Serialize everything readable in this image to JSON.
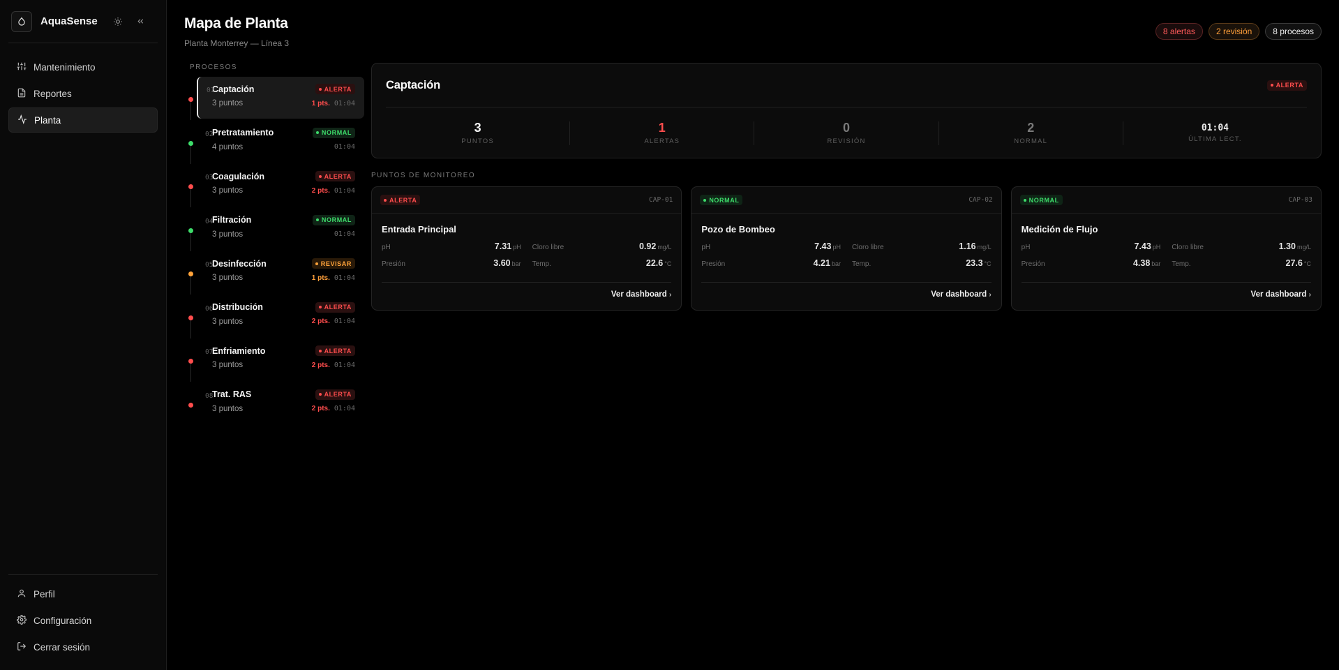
{
  "brand": {
    "name": "AquaSense"
  },
  "nav": [
    {
      "label": "Mantenimiento",
      "icon": "sliders-icon"
    },
    {
      "label": "Reportes",
      "icon": "file-icon"
    },
    {
      "label": "Planta",
      "icon": "activity-icon"
    }
  ],
  "nav_bottom": [
    {
      "label": "Perfil",
      "icon": "user-icon"
    },
    {
      "label": "Configuración",
      "icon": "gear-icon"
    },
    {
      "label": "Cerrar sesión",
      "icon": "logout-icon"
    }
  ],
  "header": {
    "title": "Mapa de Planta",
    "subtitle": "Planta Monterrey — Línea 3",
    "badges": {
      "alerts": "8 alertas",
      "review": "2 revisión",
      "processes": "8 procesos"
    }
  },
  "processes": {
    "heading": "PROCESOS",
    "items": [
      {
        "num": "01",
        "name": "Captación",
        "points": "3 puntos",
        "status": "ALERTA",
        "pts": "1 pts.",
        "time": "01:04"
      },
      {
        "num": "02",
        "name": "Pretratamiento",
        "points": "4 puntos",
        "status": "NORMAL",
        "pts": "",
        "time": "01:04"
      },
      {
        "num": "03",
        "name": "Coagulación",
        "points": "3 puntos",
        "status": "ALERTA",
        "pts": "2 pts.",
        "time": "01:04"
      },
      {
        "num": "04",
        "name": "Filtración",
        "points": "3 puntos",
        "status": "NORMAL",
        "pts": "",
        "time": "01:04"
      },
      {
        "num": "05",
        "name": "Desinfección",
        "points": "3 puntos",
        "status": "REVISAR",
        "pts": "1 pts.",
        "time": "01:04"
      },
      {
        "num": "06",
        "name": "Distribución",
        "points": "3 puntos",
        "status": "ALERTA",
        "pts": "2 pts.",
        "time": "01:04"
      },
      {
        "num": "07",
        "name": "Enfriamiento",
        "points": "3 puntos",
        "status": "ALERTA",
        "pts": "2 pts.",
        "time": "01:04"
      },
      {
        "num": "08",
        "name": "Trat. RAS",
        "points": "3 puntos",
        "status": "ALERTA",
        "pts": "2 pts.",
        "time": "01:04"
      }
    ]
  },
  "summary": {
    "title": "Captación",
    "status": "ALERTA",
    "stats": [
      {
        "value": "3",
        "label": "PUNTOS"
      },
      {
        "value": "1",
        "label": "ALERTAS"
      },
      {
        "value": "0",
        "label": "REVISIÓN"
      },
      {
        "value": "2",
        "label": "NORMAL"
      },
      {
        "value": "01:04",
        "label": "ÚLTIMA LECT."
      }
    ]
  },
  "points": {
    "heading": "PUNTOS DE MONITOREO",
    "link_label": "Ver dashboard",
    "cards": [
      {
        "status": "ALERTA",
        "id": "CAP-01",
        "name": "Entrada Principal",
        "ph_label": "pH",
        "ph": "7.31",
        "ph_unit": "pH",
        "cl_label": "Cloro libre",
        "cl": "0.92",
        "cl_unit": "mg/L",
        "pres_label": "Presión",
        "pres": "3.60",
        "pres_unit": "bar",
        "temp_label": "Temp.",
        "temp": "22.6",
        "temp_unit": "°C"
      },
      {
        "status": "NORMAL",
        "id": "CAP-02",
        "name": "Pozo de Bombeo",
        "ph_label": "pH",
        "ph": "7.43",
        "ph_unit": "pH",
        "cl_label": "Cloro libre",
        "cl": "1.16",
        "cl_unit": "mg/L",
        "pres_label": "Presión",
        "pres": "4.21",
        "pres_unit": "bar",
        "temp_label": "Temp.",
        "temp": "23.3",
        "temp_unit": "°C"
      },
      {
        "status": "NORMAL",
        "id": "CAP-03",
        "name": "Medición de Flujo",
        "ph_label": "pH",
        "ph": "7.43",
        "ph_unit": "pH",
        "cl_label": "Cloro libre",
        "cl": "1.30",
        "cl_unit": "mg/L",
        "pres_label": "Presión",
        "pres": "4.38",
        "pres_unit": "bar",
        "temp_label": "Temp.",
        "temp": "27.6",
        "temp_unit": "°C"
      }
    ]
  },
  "colors": {
    "alert": "#ff4d4d",
    "normal": "#3ddc6a",
    "review": "#ffa33a"
  }
}
